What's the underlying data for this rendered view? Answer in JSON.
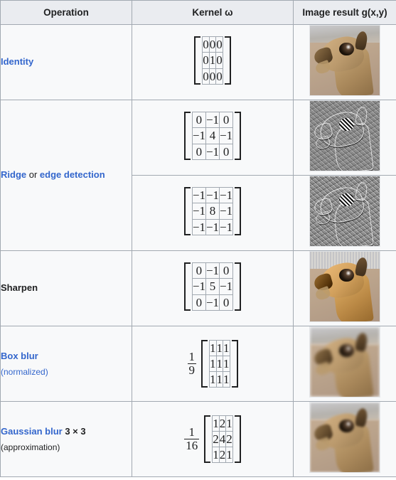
{
  "table": {
    "headers": [
      "Operation",
      "Kernel ω",
      "Image result g(x,y)"
    ],
    "rows": [
      {
        "id": "identity",
        "operation": {
          "link": "Identity",
          "suffix": "",
          "note": ""
        },
        "kernels": [
          {
            "scalar": null,
            "values": [
              [
                "0",
                "0",
                "0"
              ],
              [
                "0",
                "1",
                "0"
              ],
              [
                "0",
                "0",
                "0"
              ]
            ]
          }
        ],
        "image_alt": "identity-result-thumbnail"
      },
      {
        "id": "ridge-edge-detection",
        "operation": {
          "link": "Ridge",
          "middle": " or ",
          "link2": "edge detection",
          "note": ""
        },
        "kernels": [
          {
            "scalar": null,
            "values": [
              [
                "0",
                "−1",
                "0"
              ],
              [
                "−1",
                "4",
                "−1"
              ],
              [
                "0",
                "−1",
                "0"
              ]
            ]
          },
          {
            "scalar": null,
            "values": [
              [
                "−1",
                "−1",
                "−1"
              ],
              [
                "−1",
                "8",
                "−1"
              ],
              [
                "−1",
                "−1",
                "−1"
              ]
            ]
          }
        ],
        "image_alt": "edge-detection-result-thumbnail"
      },
      {
        "id": "sharpen",
        "operation": {
          "plain": "Sharpen",
          "note": ""
        },
        "kernels": [
          {
            "scalar": null,
            "values": [
              [
                "0",
                "−1",
                "0"
              ],
              [
                "−1",
                "5",
                "−1"
              ],
              [
                "0",
                "−1",
                "0"
              ]
            ]
          }
        ],
        "image_alt": "sharpen-result-thumbnail"
      },
      {
        "id": "box-blur",
        "operation": {
          "link": "Box blur",
          "note": "(normalized)",
          "note_style": "blue"
        },
        "kernels": [
          {
            "scalar": {
              "num": "1",
              "den": "9"
            },
            "values": [
              [
                "1",
                "1",
                "1"
              ],
              [
                "1",
                "1",
                "1"
              ],
              [
                "1",
                "1",
                "1"
              ]
            ]
          }
        ],
        "image_alt": "box-blur-result-thumbnail"
      },
      {
        "id": "gaussian-blur-3x3",
        "operation": {
          "link": "Gaussian blur",
          "suffix": " 3 × 3",
          "note": "(approximation)",
          "note_style": "dark"
        },
        "kernels": [
          {
            "scalar": {
              "num": "1",
              "den": "16"
            },
            "values": [
              [
                "1",
                "2",
                "1"
              ],
              [
                "2",
                "4",
                "2"
              ],
              [
                "1",
                "2",
                "1"
              ]
            ]
          }
        ],
        "image_alt": "gaussian-blur-result-thumbnail"
      }
    ]
  },
  "colors": {
    "link": "#3366cc",
    "text": "#202122",
    "border": "#a2a9b1",
    "header_bg": "#eaecf0",
    "cell_bg": "#f8f9fa"
  }
}
